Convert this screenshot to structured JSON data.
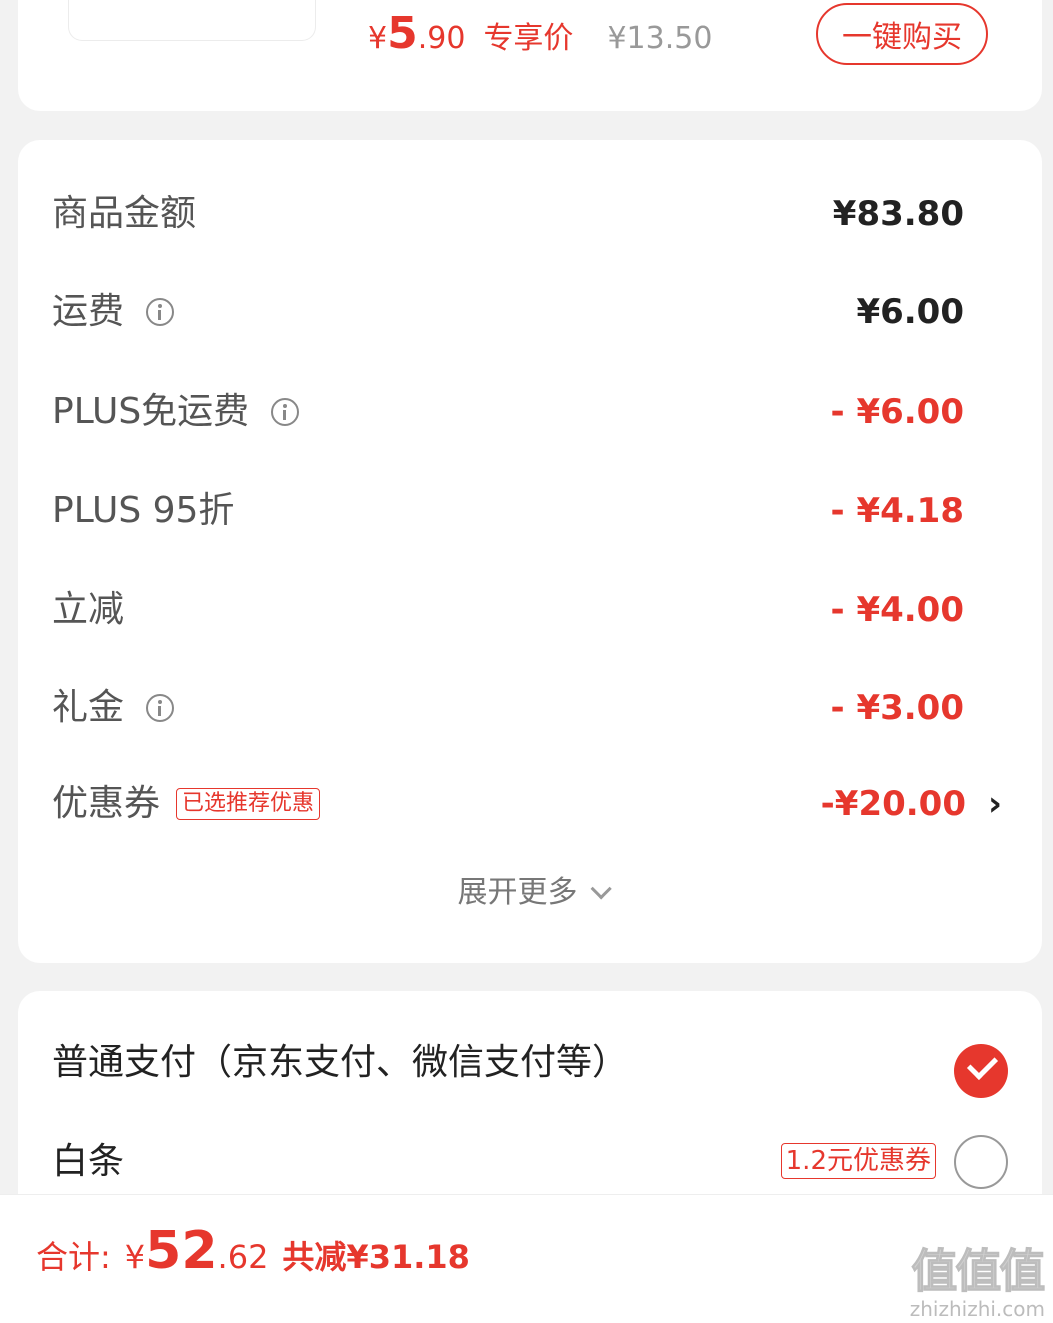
{
  "product": {
    "price_symbol": "¥",
    "price_int": "5",
    "price_dec": ".90",
    "price_tag": "专享价",
    "original_price": "¥13.50",
    "buy_button": "一键购买"
  },
  "summary": {
    "rows": [
      {
        "label": "商品金额",
        "amount": "¥83.80"
      },
      {
        "label": "运费",
        "amount": "¥6.00",
        "icon": "info-icon"
      },
      {
        "label": "PLUS免运费",
        "amount": "- ¥6.00",
        "icon": "info-icon"
      },
      {
        "label": "PLUS 95折",
        "amount": "- ¥4.18"
      },
      {
        "label": "立减",
        "amount": "- ¥4.00"
      },
      {
        "label": "礼金",
        "amount": "- ¥3.00",
        "icon": "info-icon"
      },
      {
        "label": "优惠券",
        "badge": "已选推荐优惠",
        "amount": "-¥20.00",
        "icon": "chevron-right-icon"
      }
    ],
    "chevron": "›",
    "expand": "展开更多"
  },
  "payment": {
    "normal": "普通支付（京东支付、微信支付等）",
    "baitiao": "白条",
    "baitiao_badge": "1.2元优惠券"
  },
  "footer": {
    "total_label": "合计:",
    "total_symbol": "¥",
    "total_int": "52",
    "total_dec": ".62",
    "saved": "共减¥31.18"
  },
  "watermark": {
    "main": "值值值",
    "sub": "zhizhizhi.com"
  },
  "colors": {
    "accent": "#e6372d",
    "background": "#f2f2f2"
  }
}
